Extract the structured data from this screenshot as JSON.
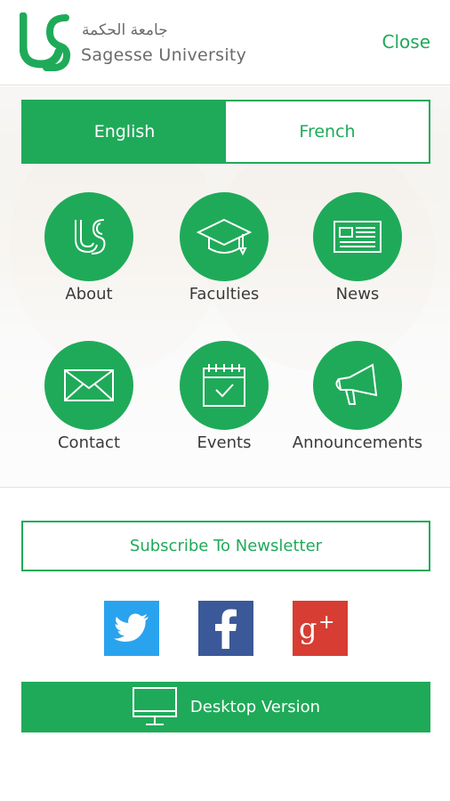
{
  "header": {
    "arabic_name": "جامعة الحكمة",
    "university_name": "Sagesse University",
    "close_label": "Close"
  },
  "language": {
    "options": [
      "English",
      "French"
    ],
    "selected": "English"
  },
  "menu": {
    "items": [
      {
        "label": "About",
        "icon": "us-logo-icon"
      },
      {
        "label": "Faculties",
        "icon": "graduation-cap-icon"
      },
      {
        "label": "News",
        "icon": "newspaper-icon"
      },
      {
        "label": "Contact",
        "icon": "envelope-icon"
      },
      {
        "label": "Events",
        "icon": "calendar-check-icon"
      },
      {
        "label": "Announcements",
        "icon": "megaphone-icon"
      }
    ]
  },
  "newsletter": {
    "label": "Subscribe To Newsletter"
  },
  "social": [
    {
      "icon": "twitter-icon",
      "color": "#2aa3ef"
    },
    {
      "icon": "facebook-icon",
      "color": "#3b5998"
    },
    {
      "icon": "google-plus-icon",
      "color": "#d73d32"
    }
  ],
  "desktop": {
    "label": "Desktop Version",
    "icon": "monitor-icon"
  },
  "colors": {
    "accent": "#1faa59"
  }
}
